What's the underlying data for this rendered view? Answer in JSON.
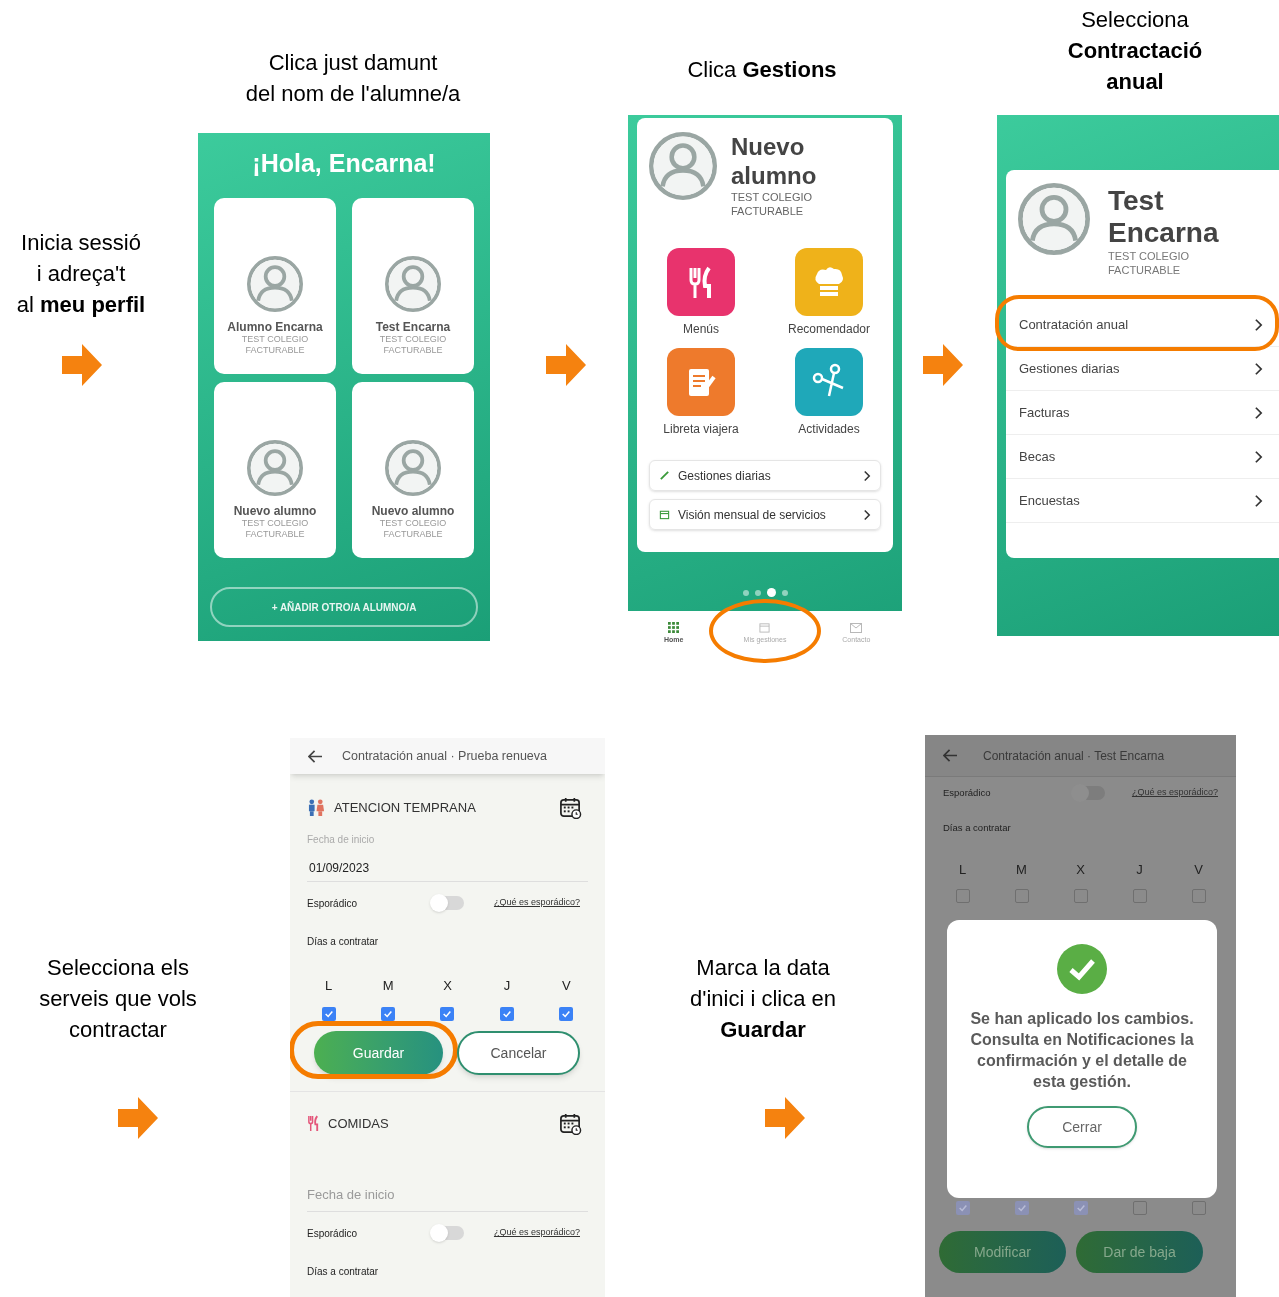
{
  "captions": [
    {
      "text": "Inicia sessió\ni adreça't\nal **meu perfil**"
    },
    {
      "text": "Clica just damunt\ndel nom de l'alumne/a"
    },
    {
      "text": "Clica **Gestions**"
    },
    {
      "text": "Selecciona\n**Contractació\nanual**"
    },
    {
      "text": "Selecciona els\nserveis que vols\ncontractar"
    },
    {
      "text": "Marca la data\nd'inici i clica en\n**Guardar**"
    }
  ],
  "home_screen": {
    "title": "¡Hola, Encarna!",
    "students": [
      {
        "name": "Alumno Encarna",
        "school": "TEST COLEGIO FACTURABLE"
      },
      {
        "name": "Test Encarna",
        "school": "TEST COLEGIO FACTURABLE"
      },
      {
        "name": "Nuevo alumno",
        "school": "TEST COLEGIO FACTURABLE"
      },
      {
        "name": "Nuevo alumno",
        "school": "TEST COLEGIO FACTURABLE"
      }
    ],
    "add_button": "+ AÑADIR OTRO/A ALUMNO/A"
  },
  "student_screen": {
    "name": "Nuevo alumno",
    "school": "TEST COLEGIO FACTURABLE",
    "tiles": [
      {
        "label": "Menús",
        "kind": "cutlery",
        "color": "#e8336d"
      },
      {
        "label": "Recomendador",
        "kind": "chef",
        "color": "#efb21a"
      },
      {
        "label": "Libreta viajera",
        "kind": "notebook",
        "color": "#ee7a2c"
      },
      {
        "label": "Actividades",
        "kind": "scissors",
        "color": "#1fa8b9"
      }
    ],
    "links": [
      {
        "label": "Gestiones diarias",
        "kind": "pencil"
      },
      {
        "label": "Visión mensual de servicios",
        "kind": "calendar"
      }
    ],
    "page_dots": [
      {
        "selected": false
      },
      {
        "selected": false
      },
      {
        "selected": true
      },
      {
        "selected": false
      }
    ],
    "nav": [
      {
        "label": "Home",
        "kind": "grid",
        "selected": true,
        "highlighted": false
      },
      {
        "label": "Mis gestiones",
        "kind": "calendar",
        "selected": false,
        "highlighted": true
      },
      {
        "label": "Contacto",
        "kind": "mail",
        "selected": false,
        "highlighted": false
      }
    ]
  },
  "menu_screen": {
    "name": "Test Encarna",
    "school": "TEST COLEGIO FACTURABLE",
    "items": [
      {
        "label": "Contratación anual",
        "highlighted": true
      },
      {
        "label": "Gestiones diarias",
        "highlighted": false
      },
      {
        "label": "Facturas",
        "highlighted": false
      },
      {
        "label": "Becas",
        "highlighted": false
      },
      {
        "label": "Encuestas",
        "highlighted": false
      }
    ]
  },
  "form_screen": {
    "header": "Contratación anual · Prueba renueva",
    "sections": [
      {
        "title": "ATENCION TEMPRANA",
        "kind": "people",
        "date_label": "Fecha de inicio",
        "date_value": "01/09/2023",
        "sporadic_label": "Esporádico",
        "sporadic_on": false,
        "sporadic_link": "¿Qué es esporádico?",
        "days_label": "Días a contratar",
        "days": [
          {
            "letter": "L",
            "checked": true
          },
          {
            "letter": "M",
            "checked": true
          },
          {
            "letter": "X",
            "checked": true
          },
          {
            "letter": "J",
            "checked": true
          },
          {
            "letter": "V",
            "checked": true
          }
        ],
        "buttons": [
          {
            "label": "Guardar",
            "kind": "primary",
            "highlighted": true
          },
          {
            "label": "Cancelar",
            "kind": "secondary",
            "highlighted": false
          }
        ]
      },
      {
        "title": "COMIDAS",
        "kind": "cutlery",
        "placeholder": "Fecha de inicio",
        "sporadic_label": "Esporádico",
        "sporadic_on": false,
        "sporadic_link": "¿Qué es esporádico?",
        "days_label": "Días a contratar"
      }
    ]
  },
  "confirm_screen": {
    "header": "Contratación anual · Test Encarna",
    "sporadic_label": "Esporádico",
    "sporadic_on": false,
    "sporadic_link": "¿Qué es esporádico?",
    "days_label": "Días a contratar",
    "days": [
      {
        "letter": "L",
        "checked": false
      },
      {
        "letter": "M",
        "checked": false
      },
      {
        "letter": "X",
        "checked": false
      },
      {
        "letter": "J",
        "checked": false
      },
      {
        "letter": "V",
        "checked": false
      }
    ],
    "lower_days": [
      {
        "checked": true
      },
      {
        "checked": true
      },
      {
        "checked": true
      },
      {
        "checked": false
      },
      {
        "checked": false
      }
    ],
    "buttons": [
      {
        "label": "Modificar"
      },
      {
        "label": "Dar de baja"
      }
    ],
    "dialog": {
      "message": "Se han aplicado los cambios. Consulta en Notificaciones la confirmación y el detalle de esta gestión.",
      "button": "Cerrar"
    }
  }
}
